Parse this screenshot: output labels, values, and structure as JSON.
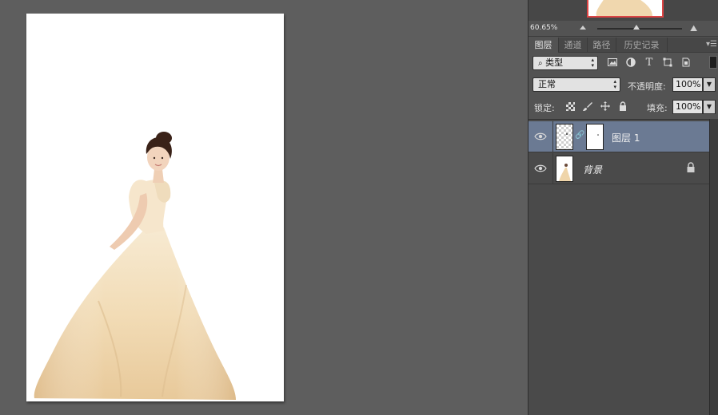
{
  "navigator": {
    "zoom": "60.65%"
  },
  "tabs": [
    {
      "label": "图层",
      "active": true
    },
    {
      "label": "通道",
      "active": false
    },
    {
      "label": "路径",
      "active": false
    },
    {
      "label": "历史记录",
      "active": false
    }
  ],
  "filter": {
    "kind_label": "类型",
    "icons": [
      "image-filter-icon",
      "adjustment-filter-icon",
      "type-filter-icon",
      "shape-filter-icon",
      "smart-object-filter-icon"
    ],
    "type_glyph": "T"
  },
  "blend": {
    "mode": "正常",
    "opacity_label": "不透明度:",
    "opacity_value": "100%"
  },
  "lock": {
    "label": "锁定:",
    "fill_label": "填充:",
    "fill_value": "100%"
  },
  "layers": [
    {
      "name": "图层 1",
      "selected": true,
      "has_mask": true
    },
    {
      "name": "背景",
      "selected": false,
      "locked": true
    }
  ],
  "colors": {
    "workspace_bg": "#5e5e5e",
    "panel_bg": "#535353",
    "selected_layer": "#6b7a93",
    "dress": "#f2ddb8"
  }
}
